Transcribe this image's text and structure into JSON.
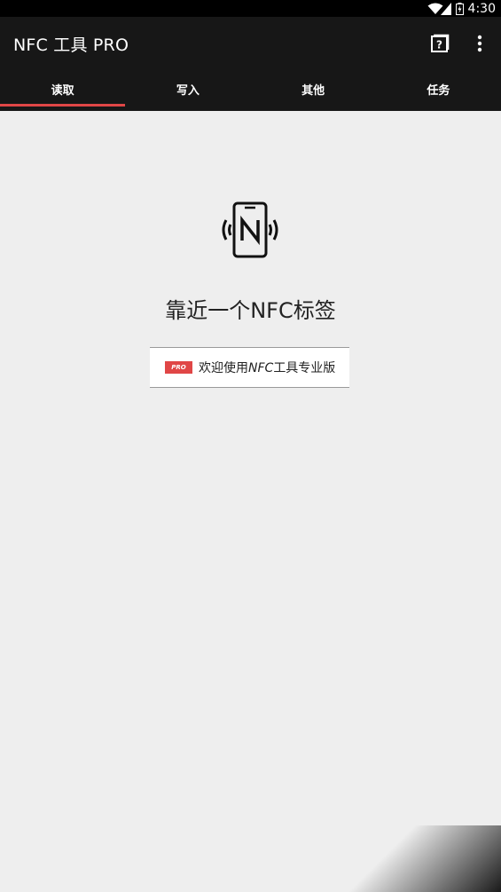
{
  "status_bar": {
    "time": "4:30",
    "icons": [
      "wifi-icon",
      "signal-icon",
      "battery-icon"
    ]
  },
  "app_bar": {
    "title": "NFC 工具 PRO",
    "actions": [
      "help-icon",
      "more-vert-icon"
    ]
  },
  "tabs": [
    {
      "label": "读取",
      "active": true
    },
    {
      "label": "写入",
      "active": false
    },
    {
      "label": "其他",
      "active": false
    },
    {
      "label": "任务",
      "active": false
    }
  ],
  "main": {
    "icon": "nfc-phone-icon",
    "prompt": "靠近一个NFC标签",
    "promo": {
      "badge": "PRO",
      "text_prefix": "欢迎使用",
      "text_italic": "NFC",
      "text_suffix": "工具专业版"
    }
  },
  "colors": {
    "accent": "#e04646",
    "app_bar": "#171717",
    "background": "#eeeeee"
  }
}
